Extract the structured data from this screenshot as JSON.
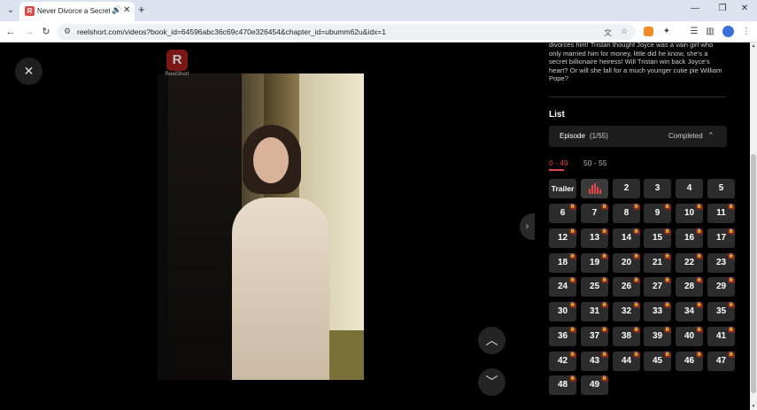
{
  "browser": {
    "tab_title": "Never Divorce a Secret Bi",
    "url": "reelshort.com/videos?book_id=64596abc36c69c470e326454&chapter_id=ubumm62u&idx=1",
    "favicon_letter": "R",
    "new_tab_symbol": "+",
    "icons": [
      "tab-search-icon",
      "audio-icon",
      "close-icon",
      "back-icon",
      "forward-icon",
      "reload-icon",
      "translate-icon",
      "star-icon",
      "extension-icon",
      "puzzle-icon",
      "media-icon",
      "side-panel-icon",
      "profile-icon",
      "menu-icon"
    ]
  },
  "player": {
    "watermark_letter": "R",
    "watermark_text": "ReelShort",
    "close_symbol": "✕",
    "prev_symbol": "︿",
    "next_symbol": "﹀",
    "toggle_symbol": "›"
  },
  "panel": {
    "description": "divorces him! Tristan thought Joyce was a vain girl who only married him for money, little did he know, she's a secret billionaire heiress! Will Tristan win back Joyce's heart? Or will she fall for a much younger cutie pie William Pope?",
    "list_title": "List",
    "episode_label": "Episode",
    "episode_count": "(1/55)",
    "status": "Completed",
    "chevron": "^",
    "ranges": [
      "0 - 49",
      "50 - 55"
    ],
    "active_range": "0 - 49",
    "episodes": [
      "Trailer",
      "1",
      "2",
      "3",
      "4",
      "5",
      "6",
      "7",
      "8",
      "9",
      "10",
      "11",
      "12",
      "13",
      "14",
      "15",
      "16",
      "17",
      "18",
      "19",
      "20",
      "21",
      "22",
      "23",
      "24",
      "25",
      "26",
      "27",
      "28",
      "29",
      "30",
      "31",
      "32",
      "33",
      "34",
      "35",
      "36",
      "37",
      "38",
      "39",
      "40",
      "41",
      "42",
      "43",
      "44",
      "45",
      "46",
      "47",
      "48",
      "49"
    ],
    "playing_episode": "1",
    "free_episodes": [
      "Trailer",
      "1",
      "2",
      "3",
      "4",
      "5"
    ],
    "accent_color": "#e04848",
    "lock_color": "#7e2626"
  }
}
